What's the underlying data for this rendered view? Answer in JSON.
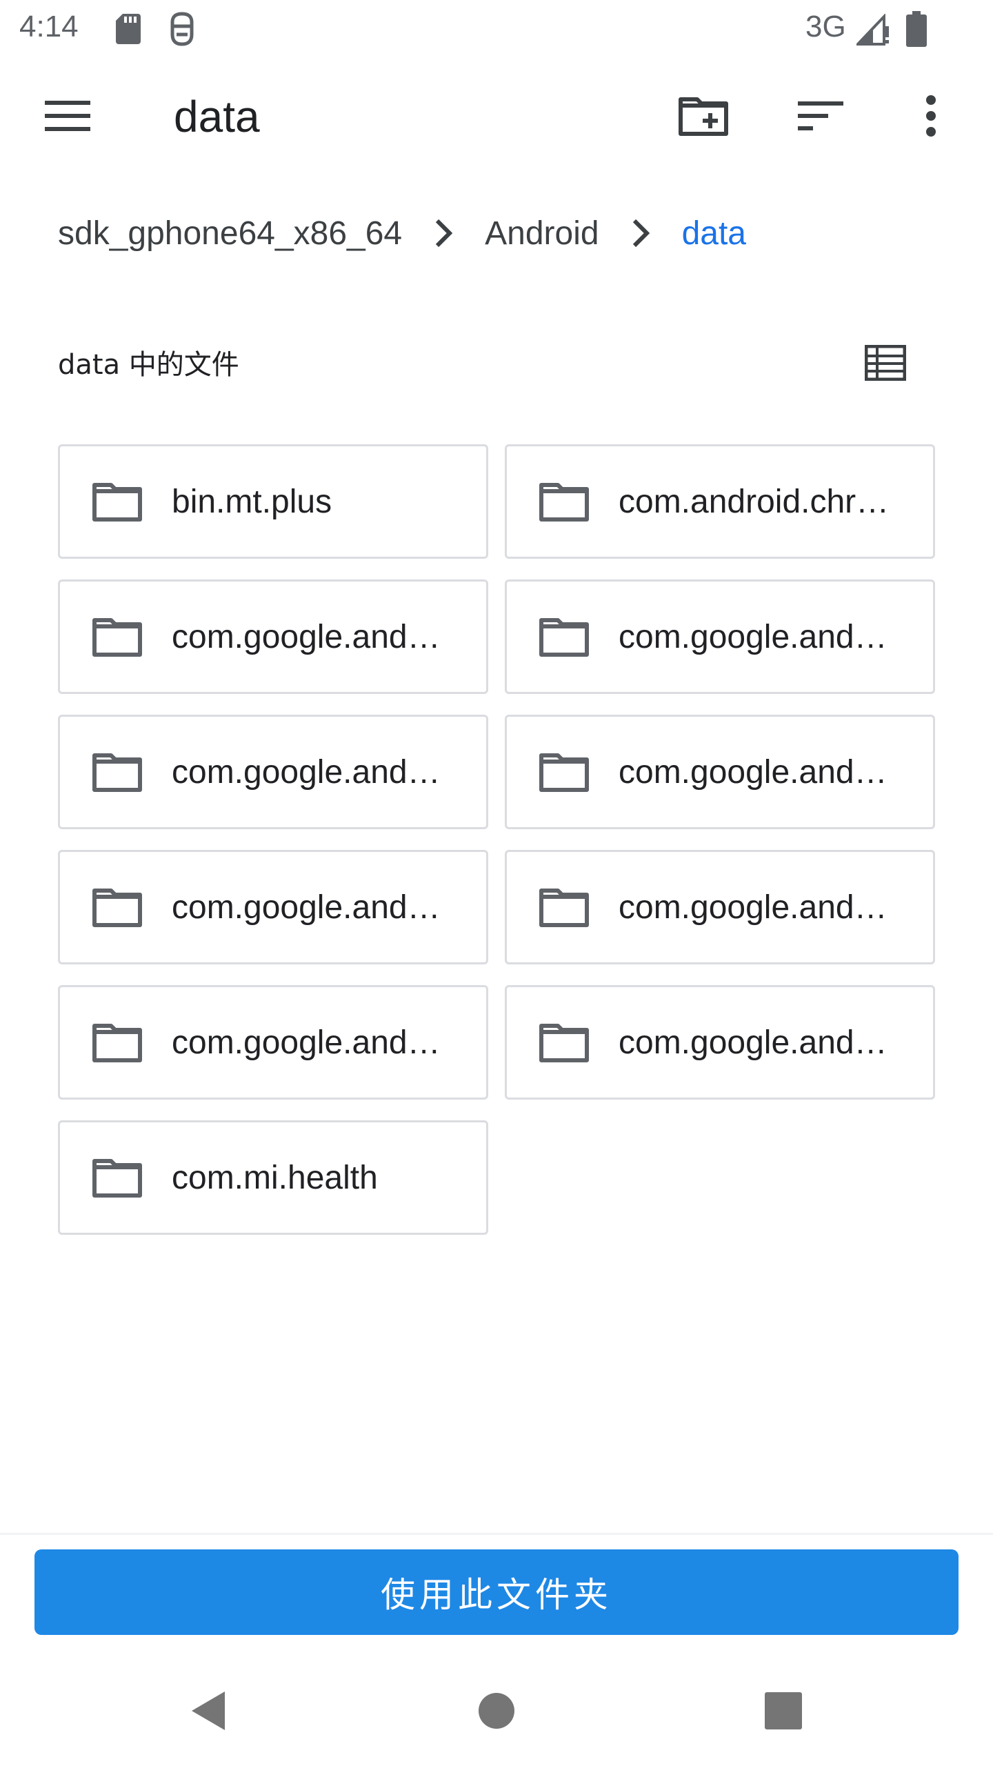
{
  "status_bar": {
    "time": "4:14",
    "network": "3G"
  },
  "toolbar": {
    "title": "data"
  },
  "breadcrumb": {
    "items": [
      "sdk_gphone64_x86_64",
      "Android",
      "data"
    ]
  },
  "section": {
    "title": "data 中的文件"
  },
  "folders": [
    "bin.mt.plus",
    "com.android.chr…",
    "com.google.andr…",
    "com.google.andr…",
    "com.google.andr…",
    "com.google.andr…",
    "com.google.andr…",
    "com.google.andr…",
    "com.google.andr…",
    "com.google.andr…",
    "com.mi.health"
  ],
  "actions": {
    "use_folder_label": "使用此文件夹"
  },
  "colors": {
    "accent": "#1a73e8",
    "button": "#1e88e5",
    "icon": "#5f6368",
    "border": "#dadce0"
  }
}
